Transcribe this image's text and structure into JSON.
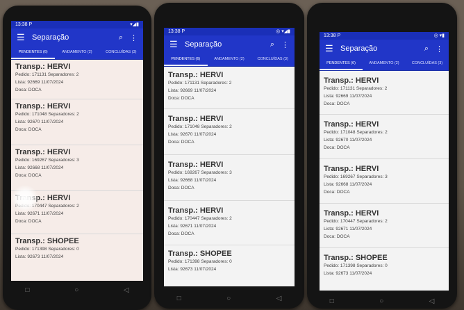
{
  "phones": [
    {
      "status": {
        "time": "13:38",
        "carrier": "P"
      },
      "appbar": {
        "title": "Separação",
        "menu_icon": "menu-icon",
        "search_icon": "search-icon",
        "more_icon": "more-vert-icon"
      },
      "tabs": [
        {
          "label": "PENDENTES (6)"
        },
        {
          "label": "ANDAMENTO (2)"
        },
        {
          "label": "CONCLUÍDAS (3)"
        }
      ],
      "items": [
        {
          "title": "Transp.: HERVI",
          "line1": "Pedido: 171131 Separadores: 2",
          "line2": "Lista: 92669 11/07/2024",
          "line3": "Doca: DOCA"
        },
        {
          "title": "Transp.: HERVI",
          "line1": "Pedido: 171048 Separadores: 2",
          "line2": "Lista: 92670 11/07/2024",
          "line3": "Doca: DOCA"
        },
        {
          "title": "Transp.: HERVI",
          "line1": "Pedido: 169267 Separadores: 3",
          "line2": "Lista: 92668 11/07/2024",
          "line3": "Doca: DOCA"
        },
        {
          "title": "Transp.: HERVI",
          "line1": "Pedido: 170447 Separadores: 2",
          "line2": "Lista: 92671 11/07/2024",
          "line3": "Doca: DOCA"
        },
        {
          "title": "Transp.: SHOPEE",
          "line1": "Pedido: 171398 Separadores: 0",
          "line2": "Lista: 92673 11/07/2024",
          "line3": ""
        }
      ]
    },
    {
      "status": {
        "time": "13:38",
        "carrier": "P"
      },
      "appbar": {
        "title": "Separação",
        "menu_icon": "menu-icon",
        "search_icon": "search-icon",
        "more_icon": "more-vert-icon"
      },
      "tabs": [
        {
          "label": "PENDENTES (6)"
        },
        {
          "label": "ANDAMENTO (2)"
        },
        {
          "label": "CONCLUÍDAS (3)"
        }
      ],
      "items": [
        {
          "title": "Transp.: HERVI",
          "line1": "Pedido: 171131 Separadores: 2",
          "line2": "Lista: 92669 11/07/2024",
          "line3": "Doca: DOCA"
        },
        {
          "title": "Transp.: HERVI",
          "line1": "Pedido: 171048 Separadores: 2",
          "line2": "Lista: 92670 11/07/2024",
          "line3": "Doca: DOCA"
        },
        {
          "title": "Transp.: HERVI",
          "line1": "Pedido: 169267 Separadores: 3",
          "line2": "Lista: 92668 11/07/2024",
          "line3": "Doca: DOCA"
        },
        {
          "title": "Transp.: HERVI",
          "line1": "Pedido: 170447 Separadores: 2",
          "line2": "Lista: 92671 11/07/2024",
          "line3": "Doca: DOCA"
        },
        {
          "title": "Transp.: SHOPEE",
          "line1": "Pedido: 171398 Separadores: 0",
          "line2": "Lista: 92673 11/07/2024",
          "line3": ""
        }
      ]
    },
    {
      "status": {
        "time": "13:38",
        "carrier": "P"
      },
      "appbar": {
        "title": "Separação",
        "menu_icon": "menu-icon",
        "search_icon": "search-icon",
        "more_icon": "more-vert-icon"
      },
      "tabs": [
        {
          "label": "PENDENTES (6)"
        },
        {
          "label": "ANDAMENTO (2)"
        },
        {
          "label": "CONCLUÍDAS (3)"
        }
      ],
      "items": [
        {
          "title": "Transp.: HERVI",
          "line1": "Pedido: 171131 Separadores: 2",
          "line2": "Lista: 92669 11/07/2024",
          "line3": "Doca: DOCA"
        },
        {
          "title": "Transp.: HERVI",
          "line1": "Pedido: 171048 Separadores: 2",
          "line2": "Lista: 92670 11/07/2024",
          "line3": "Doca: DOCA"
        },
        {
          "title": "Transp.: HERVI",
          "line1": "Pedido: 169267 Separadores: 3",
          "line2": "Lista: 92668 11/07/2024",
          "line3": "Doca: DOCA"
        },
        {
          "title": "Transp.: HERVI",
          "line1": "Pedido: 170447 Separadores: 2",
          "line2": "Lista: 92671 11/07/2024",
          "line3": "Doca: DOCA"
        },
        {
          "title": "Transp.: SHOPEE",
          "line1": "Pedido: 171398 Separadores: 0",
          "line2": "Lista: 92673 11/07/2024",
          "line3": ""
        }
      ]
    }
  ]
}
